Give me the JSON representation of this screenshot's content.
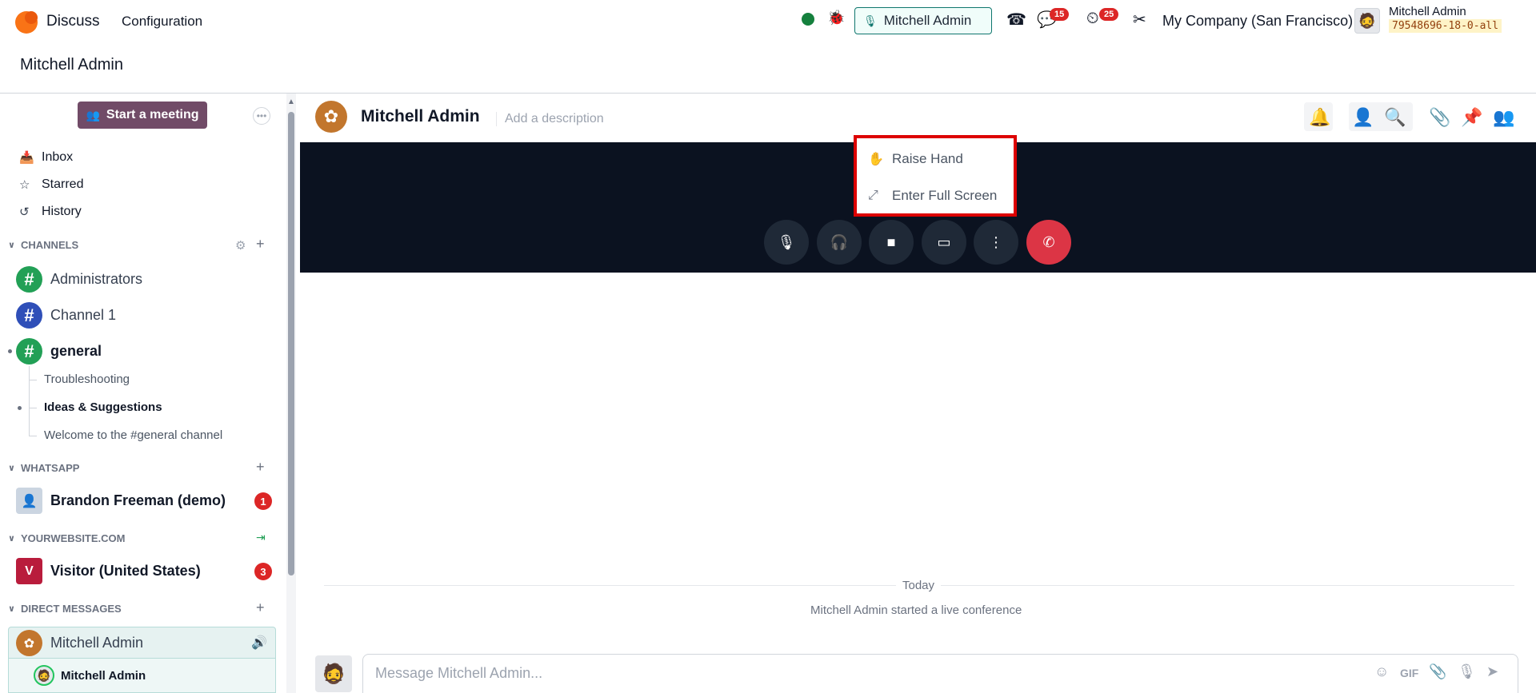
{
  "topbar": {
    "app_title": "Discuss",
    "menu": "Configuration",
    "call_user": "Mitchell Admin",
    "messages_badge": "15",
    "activities_badge": "25",
    "company": "My Company (San Francisco)",
    "user_name": "Mitchell Admin",
    "db_tag": "79548696-18-0-all"
  },
  "breadcrumb": "Mitchell Admin",
  "sidebar": {
    "start_meeting": "Start a meeting",
    "nav": [
      "Inbox",
      "Starred",
      "History"
    ],
    "sections": {
      "channels": "CHANNELS",
      "whatsapp": "WHATSAPP",
      "website": "YOURWEBSITE.COM",
      "direct": "DIRECT MESSAGES"
    },
    "channels": [
      "Administrators",
      "Channel 1",
      "general"
    ],
    "subchannels": [
      "Troubleshooting",
      "Ideas & Suggestions",
      "Welcome to the #general channel"
    ],
    "whatsapp_contact": "Brandon Freeman (demo)",
    "whatsapp_count": "1",
    "visitor": "Visitor (United States)",
    "visitor_initial": "V",
    "visitor_count": "3",
    "dm_name": "Mitchell Admin",
    "dm_member": "Mitchell Admin"
  },
  "chat": {
    "title": "Mitchell Admin",
    "description_placeholder": "Add a description",
    "menu": [
      "Raise Hand",
      "Enter Full Screen"
    ],
    "today": "Today",
    "notice": "Mitchell Admin started a live conference",
    "composer_placeholder": "Message Mitchell Admin...",
    "gif_label": "GIF"
  },
  "colors": {
    "brand": "#714b67",
    "accent": "#0f766e",
    "hangup": "#dc3545",
    "channel_green": "#22a056",
    "channel_blue": "#2f4fb8"
  }
}
